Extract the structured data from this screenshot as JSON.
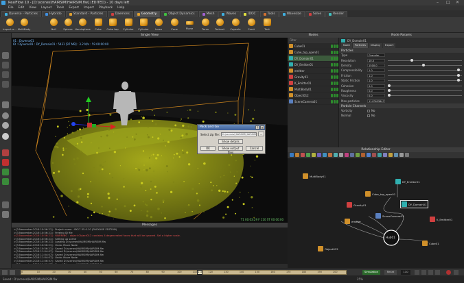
{
  "window": {
    "title": "RealFlow 10 - [D:\\scenes\\HAIRSIM\\HAIRSIM.flw] (EDITED) - 10 days left",
    "min": "–",
    "max": "□",
    "close": "✕"
  },
  "menu": [
    "File",
    "Edit",
    "View",
    "Layout",
    "Tools",
    "Export",
    "Import",
    "Playback",
    "Help"
  ],
  "tabs": [
    {
      "label": "Dyverso - Particles",
      "color": "#3fb0e0"
    },
    {
      "label": "Hybrido",
      "color": "#3f8fe0"
    },
    {
      "label": "Standard - Particles",
      "color": "#e0a030"
    },
    {
      "label": "Daemons",
      "color": "#d04040"
    },
    {
      "label": "Geometry",
      "color": "#e0a030",
      "active": true
    },
    {
      "label": "Object Dynamics",
      "color": "#40c040"
    },
    {
      "label": "Mesh",
      "color": "#a060d0"
    },
    {
      "label": "Waves",
      "color": "#3fb0e0"
    },
    {
      "label": "IDOC",
      "color": "#e0e040"
    },
    {
      "label": "Tools",
      "color": "#d07030"
    },
    {
      "label": "Wavesize",
      "color": "#3fb0e0"
    },
    {
      "label": "Solve",
      "color": "#d04040"
    },
    {
      "label": "Render",
      "color": "#40c0c0"
    }
  ],
  "shelf": [
    {
      "label": "Import o...",
      "shape": "ball",
      "icon": "import-icon"
    },
    {
      "label": "MultiBody",
      "shape": "ball",
      "icon": "multibody-icon"
    },
    {
      "label": "Null",
      "shape": "ball",
      "icon": "null-icon"
    },
    {
      "label": "Sphere",
      "shape": "ball",
      "icon": "sphere-icon"
    },
    {
      "label": "Hemisphere",
      "shape": "ball",
      "icon": "hemisphere-icon"
    },
    {
      "label": "Cube",
      "shape": "box",
      "icon": "cube-icon"
    },
    {
      "label": "Cube top",
      "shape": "box",
      "icon": "cube-top-icon"
    },
    {
      "label": "Cylinder",
      "shape": "box",
      "icon": "cylinder-icon"
    },
    {
      "label": "Cylinder",
      "shape": "box",
      "icon": "cylinder-icon"
    },
    {
      "label": "Icosa",
      "shape": "ball",
      "icon": "icosahedron-icon"
    },
    {
      "label": "Cone",
      "shape": "ball",
      "icon": "cone-icon"
    },
    {
      "label": "Plane",
      "shape": "flat",
      "icon": "plane-icon"
    },
    {
      "label": "Torus",
      "shape": "ball",
      "icon": "torus-icon"
    },
    {
      "label": "Torknot",
      "shape": "ball",
      "icon": "torusknot-icon"
    },
    {
      "label": "Capsule",
      "shape": "ball",
      "icon": "capsule-icon"
    },
    {
      "label": "Crest",
      "shape": "ball",
      "icon": "crest-icon"
    },
    {
      "label": "Text",
      "shape": "box",
      "icon": "text-icon"
    }
  ],
  "viewport": {
    "header": "Single View",
    "info_line1": "01 : Dyverso01",
    "info_line2": "ID : Dyverso01 : DY_Domain01 : 5431 [97 MB] : 3.2 M/s : 59 00:00:00",
    "bottom": "T1  00:03:29   F 110   ST 00:00:00"
  },
  "nodes": {
    "header": "Nodes",
    "filter_label": "Filter",
    "items": [
      {
        "label": "Cube01",
        "color": "#d0902a"
      },
      {
        "label": "Cube_top_open01",
        "color": "#d0902a"
      },
      {
        "label": "DY_Domain01",
        "color": "#30b0b0",
        "selected": true
      },
      {
        "label": "DY_Emitter01",
        "color": "#30b0b0"
      },
      {
        "label": "emitter",
        "color": "#d0902a"
      },
      {
        "label": "Gravity01",
        "color": "#d04040"
      },
      {
        "label": "K_Emitter01",
        "color": "#d04040"
      },
      {
        "label": "MultiBody01",
        "color": "#d0902a"
      },
      {
        "label": "Object012",
        "color": "#d0902a"
      },
      {
        "label": "SceneCamera01",
        "color": "#5a80c0"
      }
    ]
  },
  "params": {
    "header": "Node Params",
    "node_name": "DY_Domain01",
    "tabs": [
      "Node",
      "Particles",
      "Display",
      "Export"
    ],
    "sections": [
      "Particles",
      "Particle Channels"
    ],
    "rows": [
      {
        "label": "Type",
        "value": "Granular"
      },
      {
        "label": "Resolution",
        "value": "10.0",
        "level": 0.32
      },
      {
        "label": "Density",
        "value": "1500.0",
        "level": 0.48
      },
      {
        "label": "Compressibility",
        "value": "1.0",
        "level": 0.95
      },
      {
        "label": "Friction",
        "value": "1.0",
        "level": 0.95
      },
      {
        "label": "Static Friction",
        "value": "1.0",
        "level": 0.95
      },
      {
        "label": "Cohesion",
        "value": "0.0",
        "level": 0.02
      },
      {
        "label": "Roughness",
        "value": "0.0",
        "level": 0.02
      },
      {
        "label": "Viscosity",
        "value": "0.0",
        "level": 0.02
      },
      {
        "label": "Max particles",
        "value": "1147483647"
      }
    ],
    "channel_rows": [
      {
        "label": "Vorticity",
        "value": "No"
      },
      {
        "label": "Normal",
        "value": "No"
      }
    ]
  },
  "relationship": {
    "header": "Relationship Editor",
    "nodes": [
      {
        "label": "MultiBody01",
        "color": "#d0902a"
      },
      {
        "label": "DY_Emitter01",
        "color": "#30b0b0"
      },
      {
        "label": "Cube_top_open01",
        "color": "#d0902a"
      },
      {
        "label": "Gravity01",
        "color": "#d04040"
      },
      {
        "label": "DY_Domain01",
        "color": "#30b0b0"
      },
      {
        "label": "SceneCamera01",
        "color": "#5a80c0"
      },
      {
        "label": "K_Emitter01",
        "color": "#d04040"
      },
      {
        "label": "emitter",
        "color": "#d0902a"
      },
      {
        "label": "Hub01",
        "color": "#ffffff"
      },
      {
        "label": "Object012",
        "color": "#d0902a"
      },
      {
        "label": "Cube01",
        "color": "#d0902a"
      }
    ]
  },
  "dialog": {
    "title": "Pack and Go",
    "field_label": "Select zip file:",
    "field_value": "D:\\scenes\\HAIRSIM\\HAIRSIM.zip",
    "browse": "...",
    "show_details": "Show details",
    "ok": "OK",
    "show_output": "Show output files",
    "cancel": "Cancel"
  },
  "messages": {
    "header": "Messages",
    "lines": [
      {
        "text": ">[3.November.2016 10:56:21] : Project name : SK17.35.0.10 (PACKAGE EDITION)",
        "err": false
      },
      {
        "text": ">[3.November.2016 10:56:21] : Freeing ID file",
        "err": false
      },
      {
        "text": ">[3.November.2016 10:56:21] : WARNING : object Object012 contains 4 degenerated faces that will be ignored. Set a higher scale.",
        "err": true
      },
      {
        "text": ">[3.November.2016 10:56:21] : Setting up scene",
        "err": false
      },
      {
        "text": ">[3.November.2016 10:56:21] : Loading D:\\scenes\\HAIRSIM\\HAIRSIM.flw",
        "err": false
      },
      {
        "text": ">[3.November.2016 10:56:21] : Undo: Move Node",
        "err": false
      },
      {
        "text": ">[3.November.2016 10:56:21] : Saved D:\\scenes\\HAIRSIM\\HAIRSIM.flw",
        "err": false
      },
      {
        "text": ">[3.November.2016 11:04:07] : Saved D:\\scenes\\HAIRSIM\\HAIRSIM.flw",
        "err": false
      },
      {
        "text": ">[3.November.2016 11:04:07] : Saved D:\\scenes\\HAIRSIM\\HAIRSIM.flw",
        "err": false
      },
      {
        "text": ">[3.November.2016 11:04:07] : Undo: Move Node",
        "err": false
      },
      {
        "text": ">[3.November.2016 11:06:57] : Saved D:\\scenes\\HAIRSIM\\HAIRSIM.flw",
        "err": false
      },
      {
        "text": ">[3.November.2016 11:06:57] : Saved D:\\scenes\\HAIRSIM\\HAIRSIM.flw",
        "err": false
      }
    ]
  },
  "timeline": {
    "frame": "110",
    "ticks": [
      "0",
      "10",
      "20",
      "30",
      "40",
      "50",
      "60",
      "70",
      "80",
      "90",
      "100",
      "110",
      "120",
      "130",
      "140",
      "150",
      "160",
      "170",
      "180",
      "190",
      "200"
    ],
    "mode": "Simulation",
    "reset": "Reset",
    "current_frame": "110",
    "progress": 0.55
  },
  "status": {
    "left": "Saved : D:\\scenes\\HAIRSIM\\HAIRSIM.flw",
    "zoom": "25%"
  }
}
